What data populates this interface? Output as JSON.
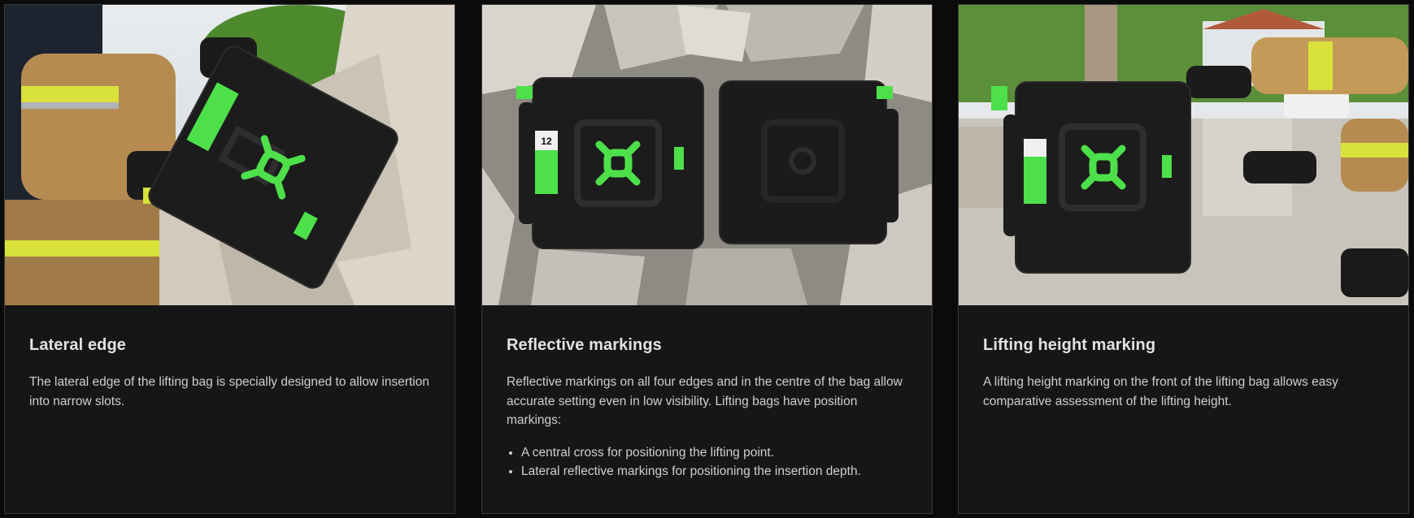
{
  "cards": [
    {
      "title": "Lateral edge",
      "text": "The lateral edge of the lifting bag is specially designed to allow insertion into narrow slots.",
      "image_alt": "Firefighter inserting a lifting bag into a narrow slot between concrete blocks"
    },
    {
      "title": "Reflective markings",
      "text": "Reflective markings on all four edges and in the centre of the bag allow accurate setting even in low visibility. Lifting bags have position markings:",
      "bullets": [
        "A central cross for positioning the lifting point.",
        "Lateral reflective markings for positioning the insertion depth."
      ],
      "image_alt": "Two black lifting bags lying on concrete rubble, front and back side"
    },
    {
      "title": "Lifting height marking",
      "text": "A lifting height marking on the front of the lifting bag allows easy comparative assessment of the lifting height.",
      "image_alt": "Firefighter positioning a lifting bag under a concrete block"
    }
  ],
  "bag_label": "12",
  "colors": {
    "page_bg": "#0b0b0b",
    "card_bg": "#161616",
    "card_border": "#3a3a3a",
    "accent_green": "#4ee04a",
    "reflective_yellow": "#e6f23a",
    "bag_black": "#1c1c1c"
  }
}
